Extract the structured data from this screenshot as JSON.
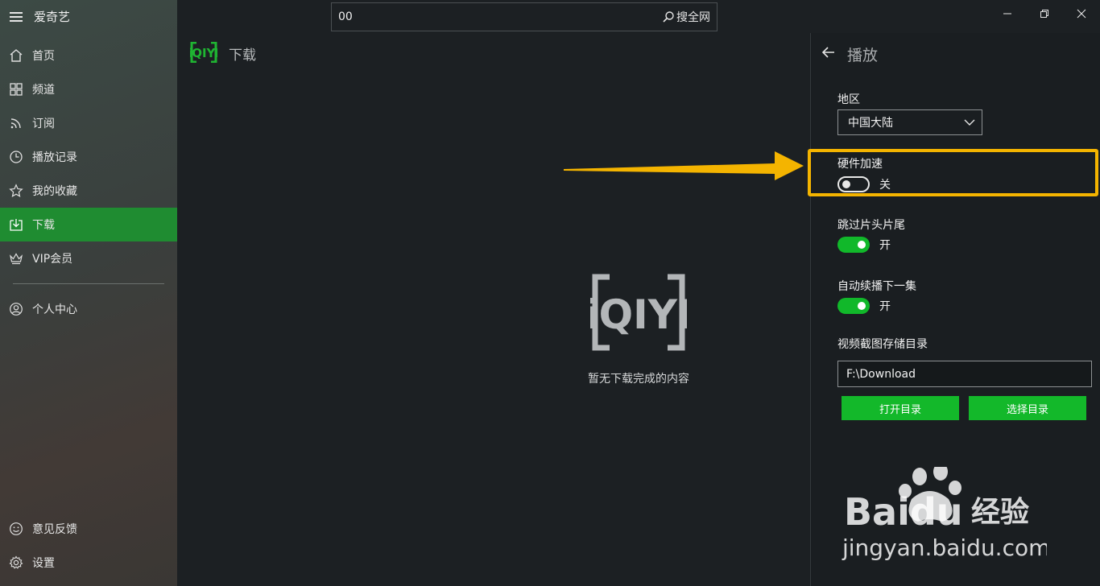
{
  "app": {
    "title": "爱奇艺"
  },
  "sidebar": {
    "items": [
      {
        "label": "首页",
        "icon": "home-icon"
      },
      {
        "label": "频道",
        "icon": "grid-icon"
      },
      {
        "label": "订阅",
        "icon": "rss-icon"
      },
      {
        "label": "播放记录",
        "icon": "clock-icon"
      },
      {
        "label": "我的收藏",
        "icon": "star-icon"
      },
      {
        "label": "下载",
        "icon": "download-icon",
        "active": true
      },
      {
        "label": "VIP会员",
        "icon": "crown-icon"
      }
    ],
    "profile": {
      "label": "个人中心",
      "icon": "user-icon"
    },
    "bottom": [
      {
        "label": "意见反馈",
        "icon": "smiley-icon"
      },
      {
        "label": "设置",
        "icon": "gear-icon"
      }
    ]
  },
  "search": {
    "value": "00",
    "button_label": "搜全网"
  },
  "content": {
    "page_title": "下载",
    "logo_text": "iQIYI",
    "empty_message": "暂无下载完成的内容"
  },
  "panel": {
    "title": "播放",
    "region": {
      "label": "地区",
      "value": "中国大陆"
    },
    "hw_accel": {
      "label": "硬件加速",
      "state": "关",
      "on": false
    },
    "skip": {
      "label": "跳过片头片尾",
      "state": "开",
      "on": true
    },
    "autoplay": {
      "label": "自动续播下一集",
      "state": "开",
      "on": true
    },
    "screenshot_dir": {
      "label": "视频截图存储目录",
      "value": "F:\\Download"
    },
    "open_dir_label": "打开目录",
    "choose_dir_label": "选择目录"
  },
  "watermark": {
    "brand": "Baidu",
    "brand_cn": "经验",
    "url": "jingyan.baidu.com"
  },
  "colors": {
    "accent_green": "#1f8c31",
    "toggle_green": "#11b82a",
    "highlight": "#f4b400"
  }
}
